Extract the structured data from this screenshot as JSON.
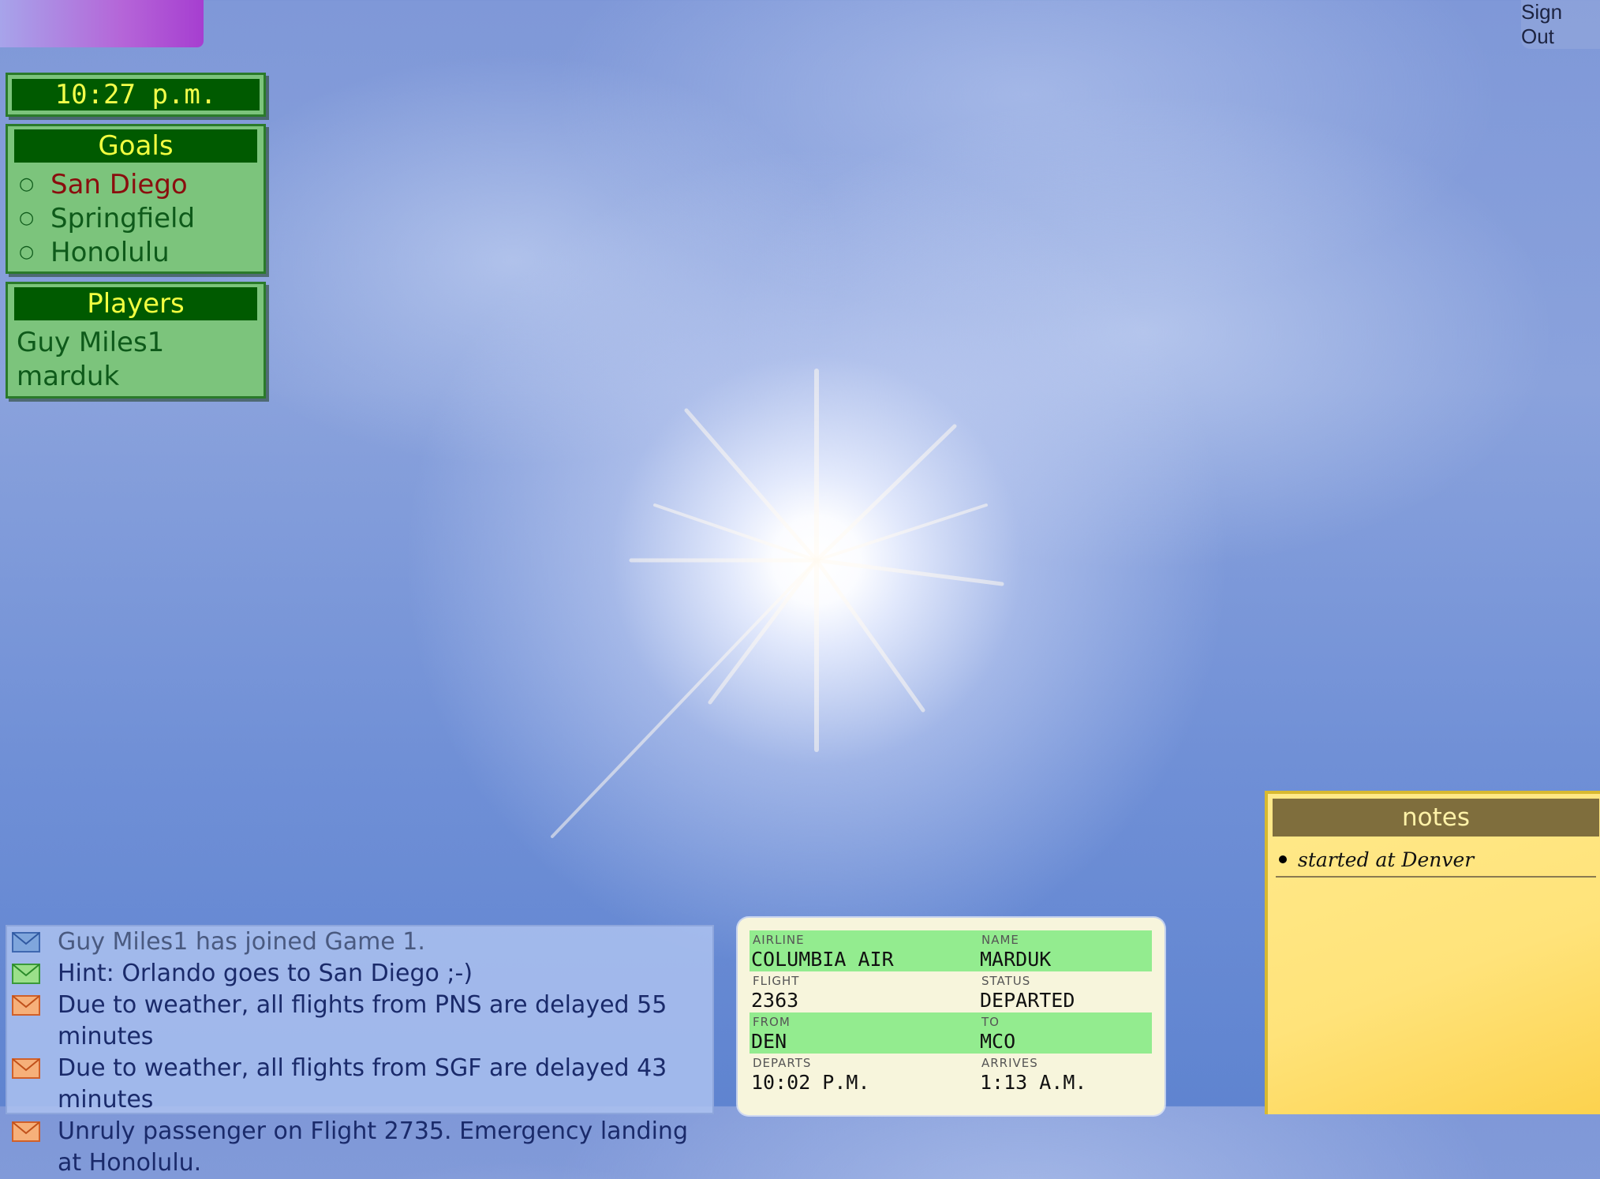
{
  "header": {
    "signout_label": "Sign Out"
  },
  "clock": {
    "time": "10:27 p.m."
  },
  "goals": {
    "title": "Goals",
    "items": [
      {
        "label": "San Diego",
        "active": true
      },
      {
        "label": "Springfield",
        "active": false
      },
      {
        "label": "Honolulu",
        "active": false
      }
    ]
  },
  "players": {
    "title": "Players",
    "items": [
      "Guy Miles1",
      "marduk"
    ]
  },
  "messages": [
    {
      "icon": "envelope-blue-icon",
      "text": "Guy Miles1 has joined Game 1."
    },
    {
      "icon": "envelope-green-icon",
      "text": "Hint: Orlando goes to San Diego ;-)"
    },
    {
      "icon": "envelope-orange-icon",
      "text": "Due to weather, all flights from PNS are delayed 55 minutes"
    },
    {
      "icon": "envelope-orange-icon",
      "text": "Due to weather, all flights from SGF are delayed 43 minutes"
    },
    {
      "icon": "envelope-orange-icon",
      "text": "Unruly passenger on Flight 2735. Emergency landing at Honolulu."
    }
  ],
  "ticket": {
    "airline_label": "AIRLINE",
    "airline": "COLUMBIA AIR",
    "name_label": "NAME",
    "name": "MARDUK",
    "flight_label": "FLIGHT",
    "flight": "2363",
    "status_label": "STATUS",
    "status": "DEPARTED",
    "from_label": "FROM",
    "from": "DEN",
    "to_label": "TO",
    "to": "MCO",
    "departs_label": "DEPARTS",
    "departs": "10:02 P.M.",
    "arrives_label": "ARRIVES",
    "arrives": "1:13 A.M."
  },
  "notes": {
    "title": "notes",
    "items": [
      "started at Denver"
    ]
  },
  "colors": {
    "panel_green": "#7cc47c",
    "header_green": "#005a00",
    "accent_yellow": "#f2ff40",
    "active_goal": "#8a0e0e"
  }
}
